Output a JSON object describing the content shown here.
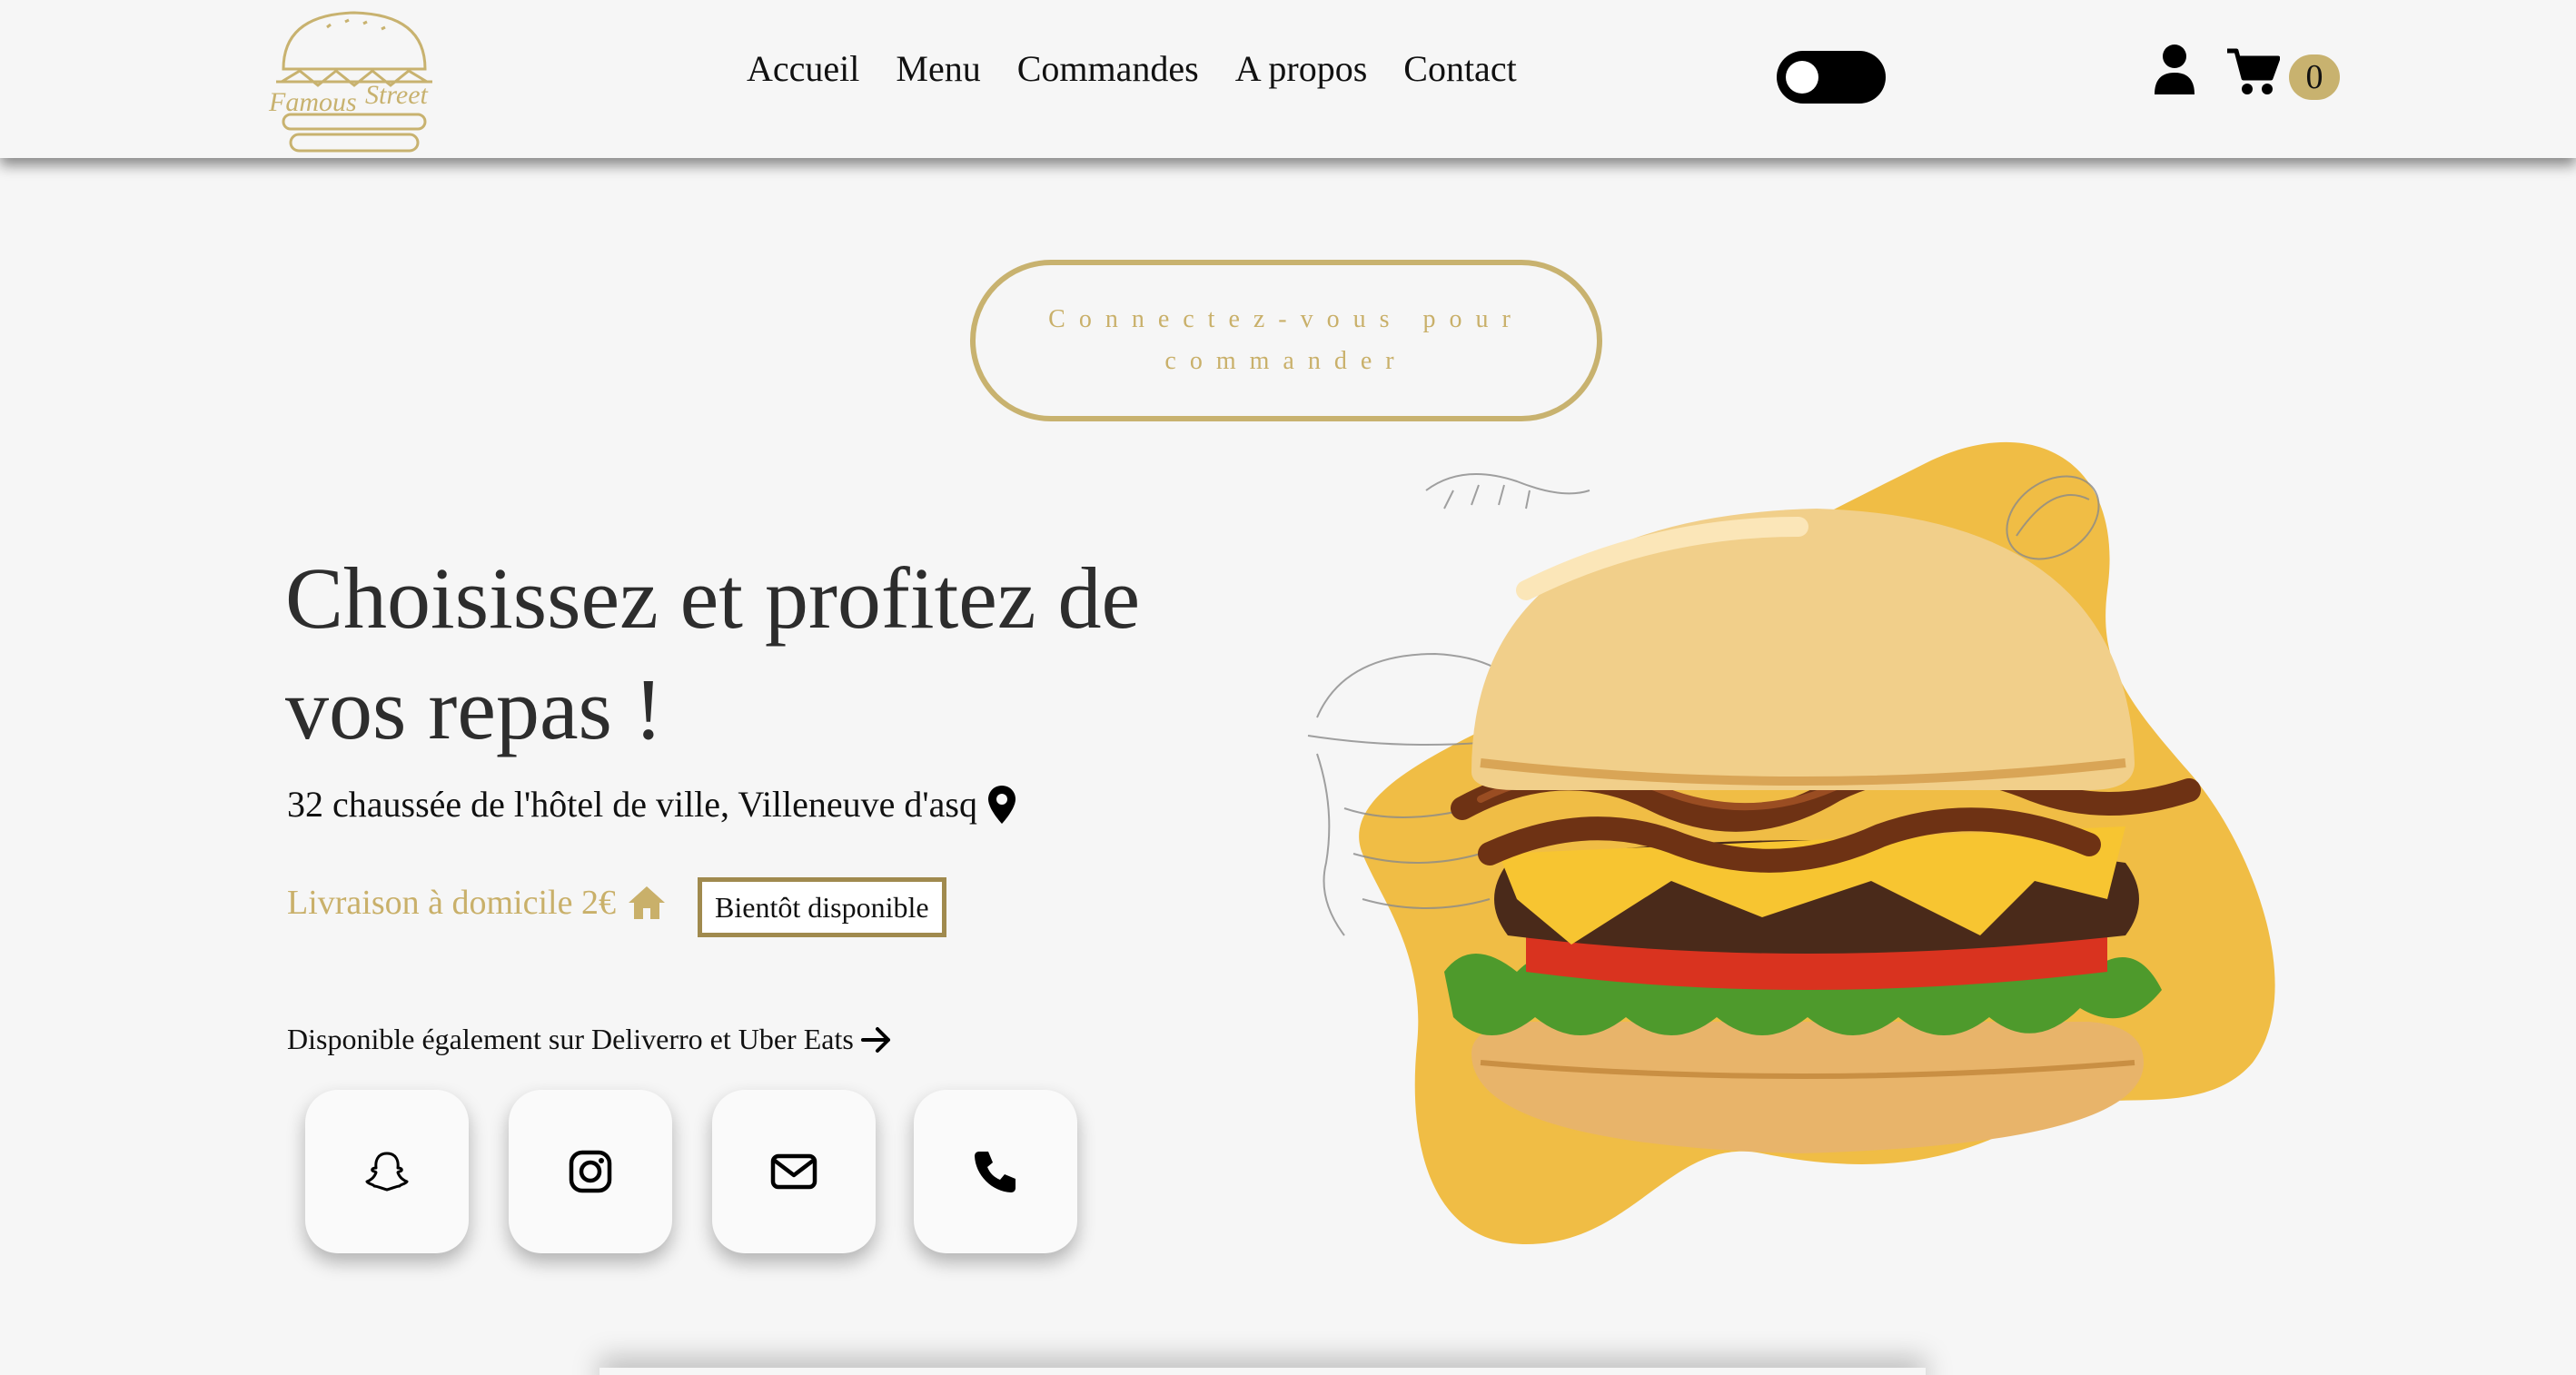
{
  "brand": {
    "logo_text_left": "Famous",
    "logo_text_right": "Street",
    "accent_color": "#c8b26f"
  },
  "nav": {
    "items": [
      {
        "label": "Accueil"
      },
      {
        "label": "Menu"
      },
      {
        "label": "Commandes"
      },
      {
        "label": "A propos"
      },
      {
        "label": "Contact"
      }
    ]
  },
  "header": {
    "theme_toggle_icon": "toggle-switch",
    "user_icon": "user-icon",
    "cart_icon": "cart-icon",
    "cart_count": "0"
  },
  "login_button": {
    "label": "Connectez-vous pour commander"
  },
  "hero": {
    "title": "Choisissez et profitez de vos repas !",
    "address": "32 chaussée de l'hôtel de ville, Villeneuve d'asq",
    "address_icon": "map-pin-icon",
    "delivery_text": "Livraison à domicile 2€",
    "delivery_icon": "home-icon",
    "soon_badge": "Bientôt disponible",
    "also_available": "Disponible également sur Deliverro et Uber Eats",
    "also_icon": "arrow-right-icon"
  },
  "socials": [
    {
      "icon": "snapchat-icon"
    },
    {
      "icon": "instagram-icon"
    },
    {
      "icon": "mail-icon"
    },
    {
      "icon": "phone-icon"
    }
  ]
}
